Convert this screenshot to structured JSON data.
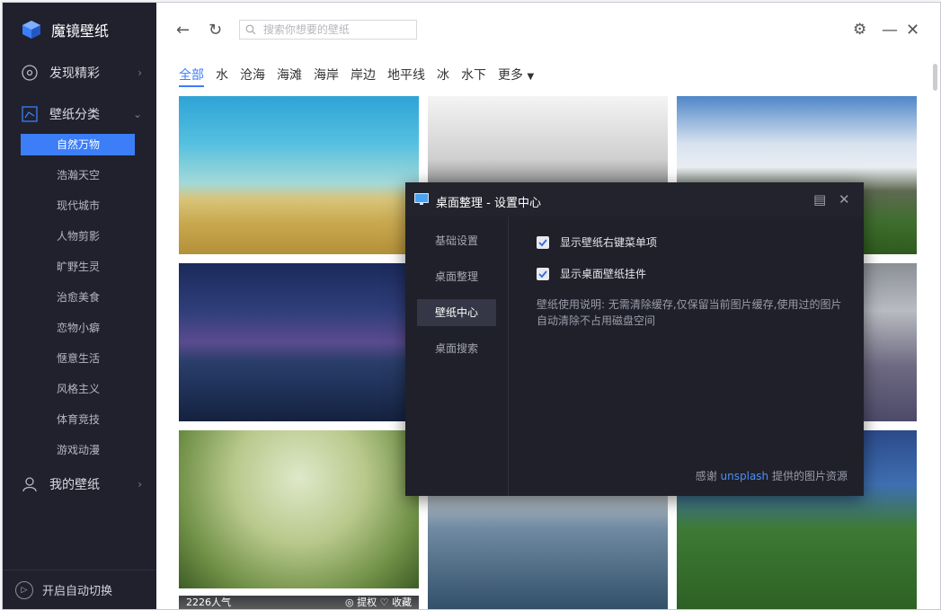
{
  "app": {
    "name": "魔镜壁纸"
  },
  "sidebar": {
    "nav": [
      {
        "label": "发现精彩"
      },
      {
        "label": "壁纸分类"
      },
      {
        "label": "我的壁纸"
      }
    ],
    "categories": [
      "自然万物",
      "浩瀚天空",
      "现代城市",
      "人物剪影",
      "旷野生灵",
      "治愈美食",
      "恋物小癖",
      "惬意生活",
      "风格主义",
      "体育竞技",
      "游戏动漫"
    ],
    "auto_switch": "开启自动切换"
  },
  "header": {
    "search_placeholder": "搜索你想要的壁纸",
    "tabs": [
      "全部",
      "水",
      "沧海",
      "海滩",
      "海岸",
      "岸边",
      "地平线",
      "冰",
      "水下"
    ],
    "more": "更多"
  },
  "tiles": {
    "bottom_caption_left": "2226人气",
    "bottom_caption_right": "◎ 提权  ♡ 收藏"
  },
  "dialog": {
    "title": "桌面整理 - 设置中心",
    "tabs": [
      "基础设置",
      "桌面整理",
      "壁纸中心",
      "桌面搜索"
    ],
    "options": [
      "显示壁纸右键菜单项",
      "显示桌面壁纸挂件"
    ],
    "note": "壁纸使用说明: 无需清除缓存,仅保留当前图片缓存,使用过的图片自动清除不占用磁盘空间",
    "credit_prefix": "感谢",
    "credit_link": "unsplash",
    "credit_suffix": "提供的图片资源"
  },
  "colors": {
    "accent": "#3c7ef8",
    "sidebar_bg": "#20212d",
    "dialog_bg": "#1f2029"
  }
}
